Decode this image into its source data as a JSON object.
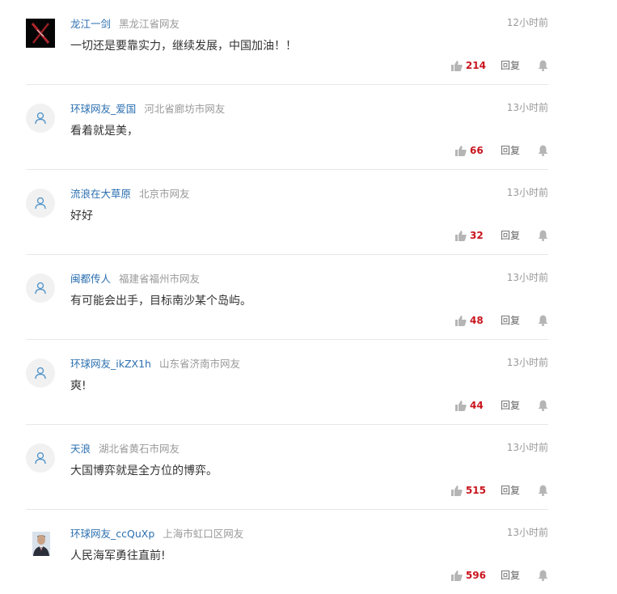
{
  "comments": [
    {
      "user": "龙江一剑",
      "location": "黑龙江省网友",
      "time": "12小时前",
      "text": "一切还是要靠实力，继续发展，中国加油！！",
      "likes": "214",
      "reply": "回复",
      "avatar": "x-logo-avatar"
    },
    {
      "user": "环球网友_爱国",
      "location": "河北省廊坊市网友",
      "time": "13小时前",
      "text": "看着就是美，",
      "likes": "66",
      "reply": "回复",
      "avatar": "default-user-icon"
    },
    {
      "user": "流浪在大草原",
      "location": "北京市网友",
      "time": "13小时前",
      "text": "好好",
      "likes": "32",
      "reply": "回复",
      "avatar": "default-user-icon"
    },
    {
      "user": "闽都传人",
      "location": "福建省福州市网友",
      "time": "13小时前",
      "text": "有可能会出手，目标南沙某个岛屿。",
      "likes": "48",
      "reply": "回复",
      "avatar": "default-user-icon"
    },
    {
      "user": "环球网友_ikZX1h",
      "location": "山东省济南市网友",
      "time": "13小时前",
      "text": "爽!",
      "likes": "44",
      "reply": "回复",
      "avatar": "default-user-icon"
    },
    {
      "user": "天浪",
      "location": "湖北省黄石市网友",
      "time": "13小时前",
      "text": "大国博弈就是全方位的博弈。",
      "likes": "515",
      "reply": "回复",
      "avatar": "default-user-icon"
    },
    {
      "user": "环球网友_ccQuXp",
      "location": "上海市虹口区网友",
      "time": "13小时前",
      "text": "人民海军勇往直前!",
      "likes": "596",
      "reply": "回复",
      "avatar": "portrait-photo-avatar"
    }
  ],
  "colors": {
    "username": "#2b6fb0",
    "likes": "#c9151e",
    "meta": "#999999",
    "icon": "#b5b5b5",
    "user_icon": "#4a90c8"
  },
  "icons": {
    "like": "thumbs-up-icon",
    "notify": "bell-icon"
  }
}
